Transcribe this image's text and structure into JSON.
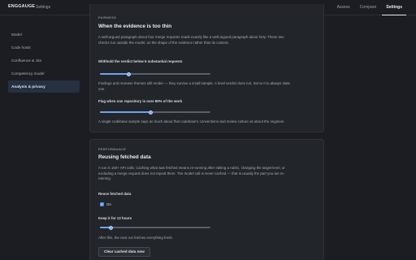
{
  "brand": {
    "name": "ENGGAUGE",
    "section": "Settings"
  },
  "topnav": [
    {
      "label": "Assess",
      "active": false
    },
    {
      "label": "Compare",
      "active": false
    },
    {
      "label": "Settings",
      "active": true
    }
  ],
  "sidebar": [
    {
      "label": "Model",
      "active": false
    },
    {
      "label": "Code hosts",
      "active": false
    },
    {
      "label": "Confluence & Jira",
      "active": false
    },
    {
      "label": "Competency model",
      "active": false
    },
    {
      "label": "Analysis & privacy",
      "active": true
    }
  ],
  "fairness": {
    "eyebrow": "FAIRNESS",
    "title": "When the evidence is too thin",
    "description": "A well-argued paragraph about four merge requests reads exactly like a well-argued paragraph about forty. These two checks run outside the model, on the shape of the evidence rather than its content.",
    "withhold": {
      "label": "Withhold the verdict below 5 substantial requests",
      "value_fraction": 0.26,
      "help": "Findings and reviewer themes still render — they survive a small sample. A level verdict does not. Set to 0 to always state one."
    },
    "flag": {
      "label": "Flag when one repository is over 80% of the work",
      "value_fraction": 0.46,
      "help": "A single-codebase sample says as much about that codebase's conventions and review culture as about the engineer."
    }
  },
  "performance": {
    "eyebrow": "PERFORMANCE",
    "title": "Reusing fetched data",
    "description": "A run is 150+ API calls. Caching what was fetched means re-running after editing a rubric, changing the target level, or excluding a merge request does not repeat them. The model call is never cached — that is usually the part you are re-running.",
    "reuse_label": "Reuse fetched data",
    "reuse_checked": true,
    "reuse_option": "On",
    "keep": {
      "label": "Keep it for 12 hours",
      "value_fraction": 0.1,
      "help": "After this, the next run fetches everything fresh."
    },
    "clear_button": "Clear cached data now"
  }
}
